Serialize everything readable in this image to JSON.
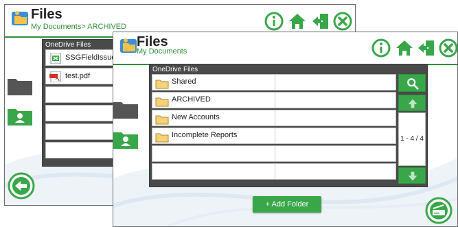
{
  "back_window": {
    "title": "Files",
    "breadcrumb": "My Documents> ARCHIVED",
    "panel_title": "OneDrive Files",
    "files": [
      {
        "name": "SSGFieldIssueF",
        "icon": "excel-file-icon"
      },
      {
        "name": "test.pdf",
        "icon": "pdf-file-icon"
      }
    ]
  },
  "front_window": {
    "title": "Files",
    "breadcrumb": "My Documents",
    "panel_title": "OneDrive Files",
    "folders": [
      {
        "name": "Shared"
      },
      {
        "name": "ARCHIVED"
      },
      {
        "name": "New Accounts"
      },
      {
        "name": "Incomplete Reports"
      }
    ],
    "pager_text": "1 - 4 / 4",
    "add_folder_label": "+ Add Folder"
  },
  "colors": {
    "accent": "#3aa64a",
    "dark_green": "#2e8f3a",
    "panel": "#4a4a4a"
  }
}
